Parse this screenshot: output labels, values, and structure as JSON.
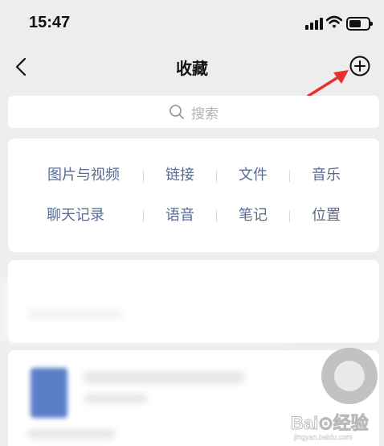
{
  "status_bar": {
    "time": "15:47",
    "icons": [
      "signal-icon",
      "wifi-icon",
      "battery-icon"
    ]
  },
  "nav": {
    "title": "收藏",
    "back_icon": "chevron-left-icon",
    "add_icon": "plus-circle-icon"
  },
  "search": {
    "icon": "search-icon",
    "placeholder": "搜索"
  },
  "categories": {
    "row1": [
      "图片与视频",
      "链接",
      "文件",
      "音乐"
    ],
    "row2": [
      "聊天记录",
      "语音",
      "笔记",
      "位置"
    ]
  },
  "annotation": {
    "arrow_color": "#e8302f"
  },
  "watermark": {
    "brand": "Bai⊙经验",
    "url": "jingyan.baidu.com"
  },
  "colors": {
    "link_blue": "#576b95",
    "background": "#ededed",
    "card": "#ffffff"
  }
}
